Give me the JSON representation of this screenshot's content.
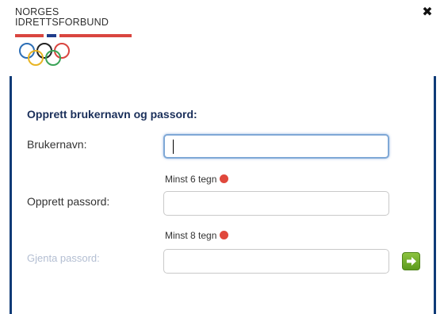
{
  "logo": {
    "line1": "NORGES",
    "line2": "IDRETTSFORBUND"
  },
  "close_icon": "close-icon",
  "form": {
    "heading": "Opprett brukernavn og passord:",
    "username_label": "Brukernavn:",
    "username_value": "",
    "username_hint": "",
    "password_hint": "Minst 6 tegn",
    "password_label": "Opprett passord:",
    "password_value": "",
    "confirm_hint": "Minst 8 tegn",
    "confirm_label": "Gjenta passord:",
    "confirm_value": "",
    "next_icon": "arrow-right-icon"
  },
  "colors": {
    "brand_red": "#d9453f",
    "brand_blue": "#1f3c8a",
    "frame_blue": "#0f3b77",
    "heading_blue": "#1a2f5a",
    "status_red": "#e0483c",
    "button_green": "#6aa82a",
    "disabled_label": "#b3bed2"
  }
}
